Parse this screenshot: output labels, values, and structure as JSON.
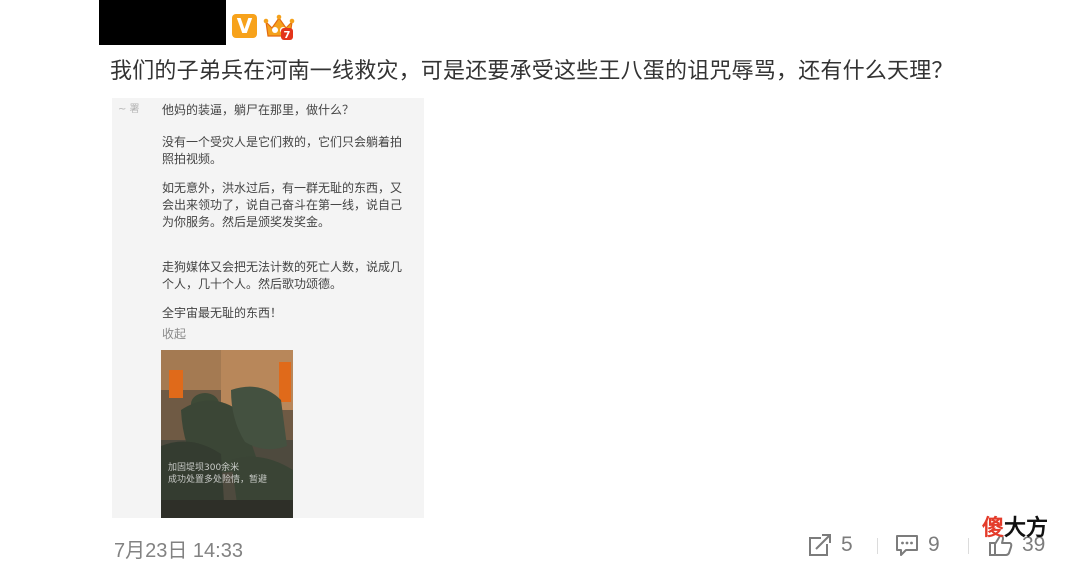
{
  "post": {
    "text": "我们的子弟兵在河南一线救灾，可是还要承受这些王八蛋的诅咒辱骂，还有什么天理？",
    "verified_badge_letter": "V"
  },
  "image": {
    "corner_mark": "~ 署",
    "paragraphs": [
      "他妈的装逼，躺尸在那里，做什么？",
      "没有一个受灾人是它们救的，它们只会躺着拍照拍视频。",
      "如无意外，洪水过后，有一群无耻的东西，又会出来领功了，说自己奋斗在第一线，说自己为你服务。然后是颁奖发奖金。",
      "走狗媒体又会把无法计数的死亡人数，说成几个人，几十个人。然后歌功颂德。",
      "全宇宙最无耻的东西！"
    ],
    "collapse_label": "收起",
    "photo_caption": "加固堤坝300余米\n成功处置多处险情，暂避"
  },
  "meta": {
    "timestamp": "7月23日 14:33"
  },
  "actions": {
    "repost_count": "5",
    "comment_count": "9",
    "like_count": "39"
  },
  "watermark": {
    "part_a": "傻",
    "part_b": "大方"
  },
  "colors": {
    "timestamp": "#828282",
    "badge_bg": "#f7a21b",
    "badge_letter": "#e0161b",
    "watermark_red": "#e43b2a"
  }
}
